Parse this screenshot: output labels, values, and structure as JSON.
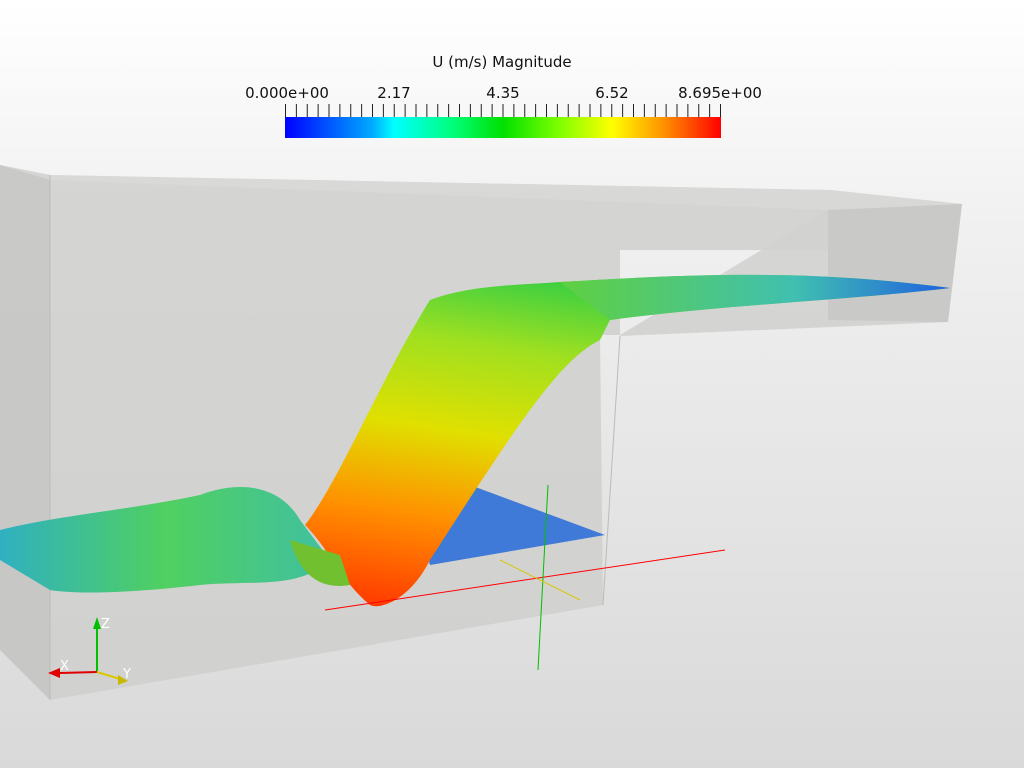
{
  "colorbar": {
    "title": "U (m/s) Magnitude",
    "labels": [
      "0.000e+00",
      "2.17",
      "4.35",
      "6.52",
      "8.695e+00"
    ],
    "range": [
      0,
      8.695
    ],
    "colors": [
      "#0000ff",
      "#00ffff",
      "#00e000",
      "#ffff00",
      "#ff0000"
    ]
  },
  "axes": {
    "x": "X",
    "y": "Y",
    "z": "Z",
    "x_color": "#e00000",
    "y_color": "#d8c800",
    "z_color": "#00c000"
  }
}
